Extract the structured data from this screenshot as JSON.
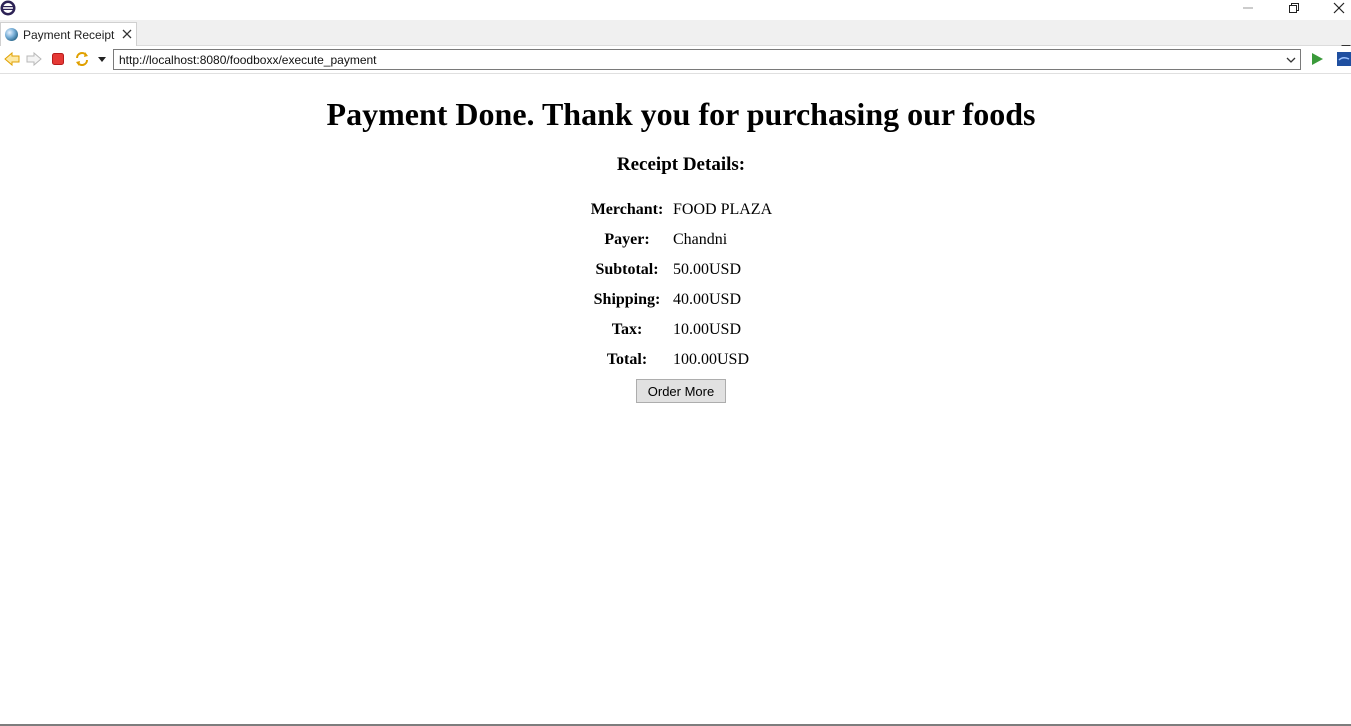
{
  "window": {
    "tab_title": "Payment Receipt"
  },
  "navbar": {
    "url": "http://localhost:8080/foodboxx/execute_payment"
  },
  "page": {
    "heading": "Payment Done. Thank you for purchasing our foods",
    "receipt_heading": "Receipt Details:",
    "rows": [
      {
        "label": "Merchant:",
        "value": "FOOD PLAZA"
      },
      {
        "label": "Payer:",
        "value": "Chandni"
      },
      {
        "label": "Subtotal:",
        "value": "50.00USD"
      },
      {
        "label": "Shipping:",
        "value": "40.00USD"
      },
      {
        "label": "Tax:",
        "value": "10.00USD"
      },
      {
        "label": "Total:",
        "value": "100.00USD"
      }
    ],
    "order_more_label": "Order More"
  },
  "icons": {
    "app": "eclipse-icon",
    "back": "back-arrow-icon",
    "forward": "forward-arrow-icon",
    "stop": "stop-icon",
    "refresh": "refresh-icon",
    "go": "go-play-icon"
  },
  "colors": {
    "back_arrow": "#f2a900",
    "stop": "#e53935",
    "go": "#3a9a3a"
  }
}
